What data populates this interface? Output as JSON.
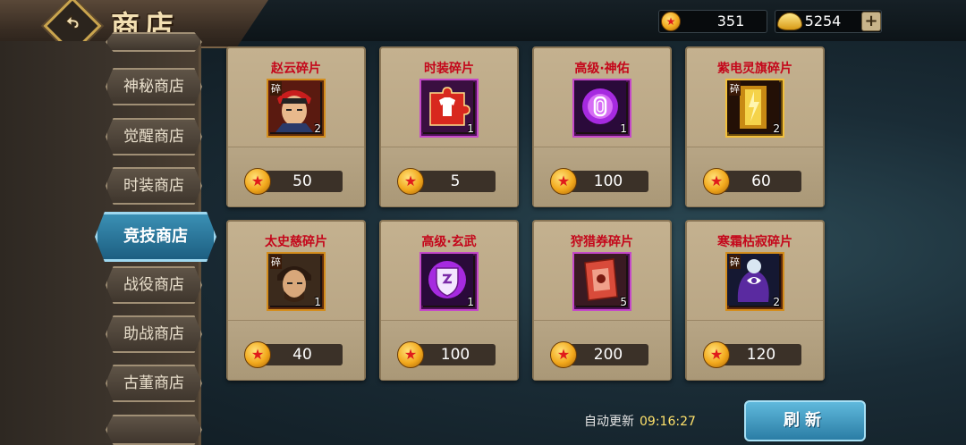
{
  "header": {
    "title": "商店",
    "back_icon": "back-arrow-icon",
    "currencies": [
      {
        "icon": "coin-icon",
        "value": "351"
      },
      {
        "icon": "gold-ingot-icon",
        "value": "5254"
      }
    ],
    "add_label": "+"
  },
  "sidebar": {
    "tabs": [
      {
        "label": "神秘商店"
      },
      {
        "label": "觉醒商店"
      },
      {
        "label": "时装商店"
      },
      {
        "label": "竞技商店",
        "active": true
      },
      {
        "label": "战役商店"
      },
      {
        "label": "助战商店"
      },
      {
        "label": "古董商店"
      }
    ]
  },
  "items": [
    {
      "name": "赵云碎片",
      "qty": "2",
      "price": "50",
      "frag": "碎",
      "icon": "zhao-yun-portrait-icon"
    },
    {
      "name": "时装碎片",
      "qty": "1",
      "price": "5",
      "frag": "",
      "icon": "costume-fragment-icon"
    },
    {
      "name": "高级·神佑",
      "qty": "1",
      "price": "100",
      "frag": "",
      "icon": "divine-blessing-orb-icon"
    },
    {
      "name": "紫电灵旗碎片",
      "qty": "2",
      "price": "60",
      "frag": "碎",
      "icon": "lightning-banner-icon"
    },
    {
      "name": "太史慈碎片",
      "qty": "1",
      "price": "40",
      "frag": "碎",
      "icon": "taishi-ci-portrait-icon"
    },
    {
      "name": "高级·玄武",
      "qty": "1",
      "price": "100",
      "frag": "",
      "icon": "xuanwu-shield-orb-icon"
    },
    {
      "name": "狩猎券碎片",
      "qty": "5",
      "price": "200",
      "frag": "",
      "icon": "hunting-ticket-icon"
    },
    {
      "name": "寒霜枯寂碎片",
      "qty": "2",
      "price": "120",
      "frag": "碎",
      "icon": "frost-relic-icon"
    }
  ],
  "footer": {
    "auto_update_label": "自动更新",
    "auto_update_time": "09:16:27",
    "refresh_label": "刷新"
  },
  "colors": {
    "item_name": "#c4071b",
    "active_tab": "#2b7da5",
    "timer": "#ffe26b"
  }
}
